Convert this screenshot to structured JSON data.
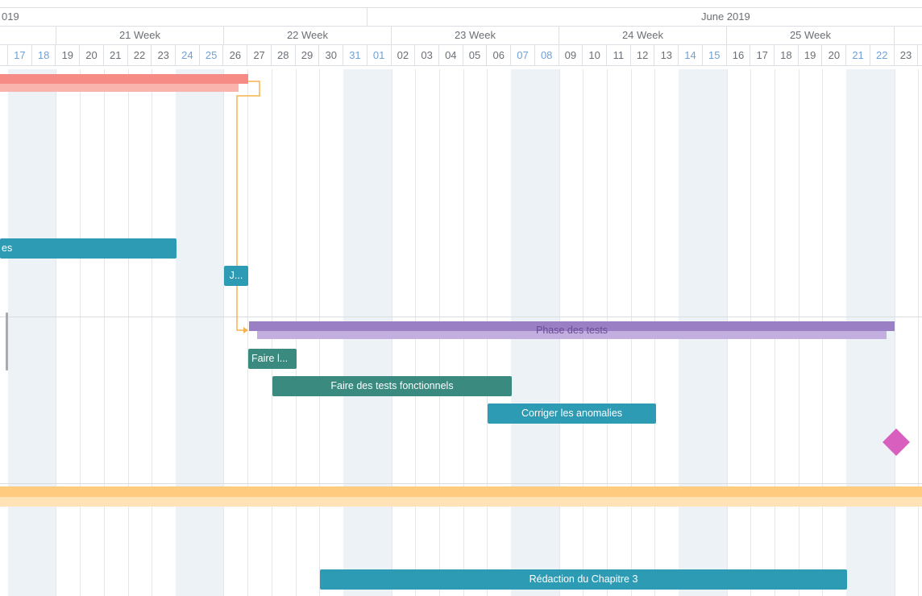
{
  "header": {
    "months": [
      {
        "label": "019"
      },
      {
        "label": "June 2019"
      }
    ],
    "weeks": [
      {
        "label": "21 Week"
      },
      {
        "label": "22 Week"
      },
      {
        "label": "23 Week"
      },
      {
        "label": "24 Week"
      },
      {
        "label": "25 Week"
      }
    ],
    "days": [
      "17",
      "18",
      "19",
      "20",
      "21",
      "22",
      "23",
      "24",
      "25",
      "26",
      "27",
      "28",
      "29",
      "30",
      "31",
      "01",
      "02",
      "03",
      "04",
      "05",
      "06",
      "07",
      "08",
      "09",
      "10",
      "11",
      "12",
      "13",
      "14",
      "15",
      "16",
      "17",
      "18",
      "19",
      "20",
      "21",
      "22",
      "23"
    ],
    "weekend_days": [
      0,
      1,
      7,
      8,
      14,
      15,
      21,
      22,
      28,
      29,
      35,
      36
    ]
  },
  "tasks": {
    "red_summary_colors": {
      "top": "#f58b84",
      "bottom": "#f9b4ae"
    },
    "task_s_label": "es",
    "task_j_label": "J...",
    "phase_tests_label": "Phase des tests",
    "phase_colors": {
      "top": "#9b7fc4",
      "bottom": "#c2afe0",
      "text": "#6a4a96"
    },
    "faire_l_label": "Faire l...",
    "tests_fonctionnels_label": "Faire des tests fonctionnels",
    "corriger_label": "Corriger les anomalies",
    "orange_summary_colors": {
      "top": "#ffcb7f",
      "bottom": "#ffe2b5"
    },
    "redaction_label": "Rédaction du Chapitre 3",
    "link_color": "#f6b24f",
    "milestone_color": "#d95fbf"
  }
}
